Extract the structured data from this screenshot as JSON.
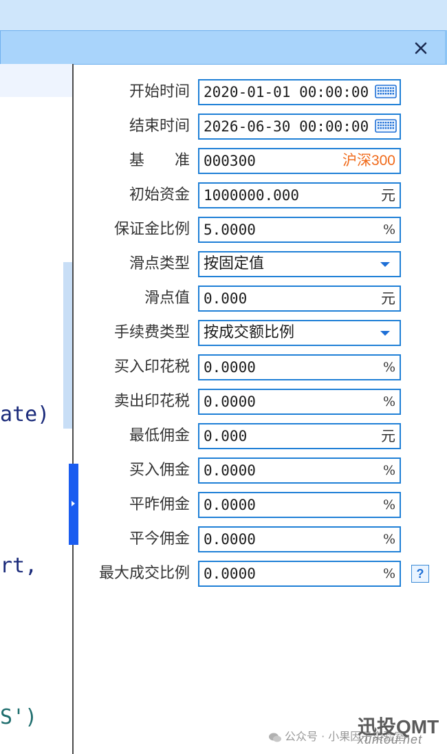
{
  "window": {
    "close_icon": "close-icon"
  },
  "code": {
    "line1": "ate)",
    "line2": "rt, ",
    "line3": "S')"
  },
  "form": {
    "fields": [
      {
        "label": "开始时间",
        "value": "2020-01-01 00:00:00",
        "icon": "keyboard-icon"
      },
      {
        "label": "结束时间",
        "value": "2026-06-30 00:00:00",
        "icon": "keyboard-icon"
      },
      {
        "label": "基　　准",
        "value": "000300",
        "suffix": "沪深300"
      },
      {
        "label": "初始资金",
        "value": "1000000.000",
        "unit": "元"
      },
      {
        "label": "保证金比例",
        "value": "5.0000",
        "unit": "%"
      },
      {
        "label": "滑点类型",
        "value": "按固定值",
        "icon": "dropdown-arrow-icon"
      },
      {
        "label": "滑点值",
        "value": "0.000",
        "unit": "元"
      },
      {
        "label": "手续费类型",
        "value": "按成交额比例",
        "icon": "dropdown-arrow-icon"
      },
      {
        "label": "买入印花税",
        "value": "0.0000",
        "unit": "%"
      },
      {
        "label": "卖出印花税",
        "value": "0.0000",
        "unit": "%"
      },
      {
        "label": "最低佣金",
        "value": "0.000",
        "unit": "元"
      },
      {
        "label": "买入佣金",
        "value": "0.0000",
        "unit": "%"
      },
      {
        "label": "平昨佣金",
        "value": "0.0000",
        "unit": "%"
      },
      {
        "label": "平今佣金",
        "value": "0.0000",
        "unit": "%"
      },
      {
        "label": "最大成交比例",
        "value": "0.0000",
        "unit": "%"
      }
    ],
    "help_label": "?"
  },
  "watermark": {
    "account": "公众号 · 小果因子实验室",
    "brand": "迅投QMT",
    "site": "xuntou.net"
  },
  "colors": {
    "field_border": "#1e7fd6",
    "title_bar": "#a9d4fb",
    "splitter": "#1a5cf0",
    "benchmark_name": "#f06a1a"
  }
}
